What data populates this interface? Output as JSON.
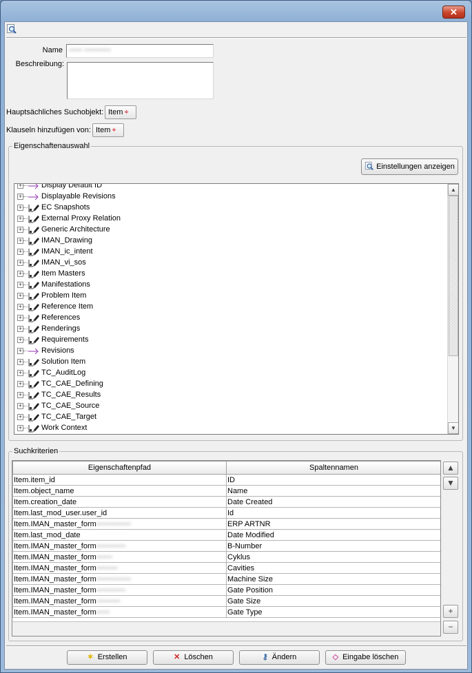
{
  "window": {
    "close_glyph": "✕"
  },
  "toolbar": {
    "search_icon": "magnifier-page-icon"
  },
  "form": {
    "name_label": "Name",
    "name_value": "••••• ••••••••••",
    "description_label": "Beschreibung:",
    "description_value": "",
    "primary_search_label": "Hauptsächliches Suchobjekt:",
    "primary_search_value": "Item",
    "clauses_label": "Klauseln hinzufügen von:",
    "clauses_value": "Item"
  },
  "properties": {
    "group_title": "Eigenschaftenauswahl",
    "settings_button": "Einstellungen anzeigen",
    "tree_items": [
      {
        "label": "Display Default ID",
        "type": "arrow"
      },
      {
        "label": "Displayable Revisions",
        "type": "arrow"
      },
      {
        "label": "EC Snapshots",
        "type": "relation"
      },
      {
        "label": "External Proxy Relation",
        "type": "relation"
      },
      {
        "label": "Generic Architecture",
        "type": "relation"
      },
      {
        "label": "IMAN_Drawing",
        "type": "relation"
      },
      {
        "label": "IMAN_ic_intent",
        "type": "relation"
      },
      {
        "label": "IMAN_vi_sos",
        "type": "relation"
      },
      {
        "label": "Item Masters",
        "type": "relation"
      },
      {
        "label": "Manifestations",
        "type": "relation"
      },
      {
        "label": "Problem Item",
        "type": "relation"
      },
      {
        "label": "Reference Item",
        "type": "relation"
      },
      {
        "label": "References",
        "type": "relation"
      },
      {
        "label": "Renderings",
        "type": "relation"
      },
      {
        "label": "Requirements",
        "type": "relation"
      },
      {
        "label": "Revisions",
        "type": "arrow"
      },
      {
        "label": "Solution Item",
        "type": "relation"
      },
      {
        "label": "TC_AuditLog",
        "type": "relation"
      },
      {
        "label": "TC_CAE_Defining",
        "type": "relation"
      },
      {
        "label": "TC_CAE_Results",
        "type": "relation"
      },
      {
        "label": "TC_CAE_Source",
        "type": "relation"
      },
      {
        "label": "TC_CAE_Target",
        "type": "relation"
      },
      {
        "label": "Work Context",
        "type": "relation"
      }
    ]
  },
  "criteria": {
    "group_title": "Suchkriterien",
    "col_path": "Eigenschaftenpfad",
    "col_name": "Spaltennamen",
    "rows": [
      {
        "path": "Item.item_id",
        "blur": "",
        "name": "ID"
      },
      {
        "path": "Item.object_name",
        "blur": "",
        "name": "Name"
      },
      {
        "path": "Item.creation_date",
        "blur": "",
        "name": "Date Created"
      },
      {
        "path": "Item.last_mod_user.user_id",
        "blur": "",
        "name": "Id"
      },
      {
        "path": "Item.IMAN_master_form",
        "blur": "•••••••••••••",
        "name": "ERP ARTNR"
      },
      {
        "path": "Item.last_mod_date",
        "blur": "",
        "name": "Date Modified"
      },
      {
        "path": "Item.IMAN_master_form",
        "blur": "•••••••••••",
        "name": "B-Number"
      },
      {
        "path": "Item.IMAN_master_form",
        "blur": "••••••",
        "name": "Cyklus"
      },
      {
        "path": "Item.IMAN_master_form",
        "blur": "••••••••",
        "name": "Cavities"
      },
      {
        "path": "Item.IMAN_master_form",
        "blur": "•••••••••••••",
        "name": "Machine Size"
      },
      {
        "path": "Item.IMAN_master_form",
        "blur": "•••••••••••",
        "name": "Gate Position"
      },
      {
        "path": "Item.IMAN_master_form",
        "blur": "•••••••••",
        "name": "Gate Size"
      },
      {
        "path": "Item.IMAN_master_form",
        "blur": "•••••",
        "name": "Gate Type"
      }
    ]
  },
  "buttons": {
    "create": "Erstellen",
    "delete": "Löschen",
    "modify": "Ändern",
    "clear": "Eingabe löschen"
  }
}
